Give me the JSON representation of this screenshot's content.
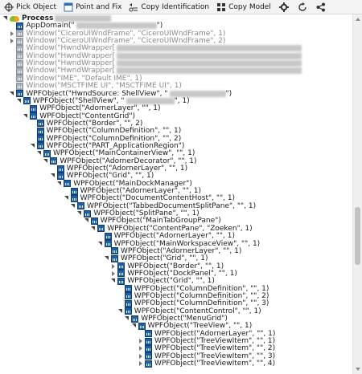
{
  "toolbar": {
    "pick_object": "Pick Object",
    "point_and_fix": "Point and Fix",
    "copy_identification": "Copy Identification",
    "copy_model": "Copy Model"
  },
  "tree": {
    "rows": [
      {
        "level": 0,
        "twisty": "open",
        "icon": "bug",
        "text": "Process",
        "redact": 70,
        "dim": false
      },
      {
        "level": 1,
        "twisty": "none",
        "icon": "node",
        "text": "AppDomain(\"",
        "redact": 100,
        "suffix": "\")",
        "dim": false
      },
      {
        "level": 1,
        "twisty": "closed",
        "icon": "gray",
        "text": "Window(\"CiceroUIWndFrame\", \"CiceroUIWndFrame\", 1)",
        "dim": true
      },
      {
        "level": 1,
        "twisty": "closed",
        "icon": "gray",
        "text": "Window(\"CiceroUIWndFrame\", \"CiceroUIWndFrame\", 2)",
        "dim": true
      },
      {
        "level": 1,
        "twisty": "none",
        "icon": "gray",
        "text": "Window(\"HwndWrapper[",
        "redact": 230,
        "dim": true
      },
      {
        "level": 1,
        "twisty": "none",
        "icon": "gray",
        "text": "Window(\"HwndWrapper[",
        "redact": 230,
        "dim": true
      },
      {
        "level": 1,
        "twisty": "none",
        "icon": "gray",
        "text": "Window(\"HwndWrapper[",
        "redact": 230,
        "dim": true
      },
      {
        "level": 1,
        "twisty": "none",
        "icon": "gray",
        "text": "Window(\"HwndWrapper[",
        "redact": 230,
        "dim": true
      },
      {
        "level": 1,
        "twisty": "none",
        "icon": "gray",
        "text": "Window(\"IME\", \"Default IME\", 1)",
        "dim": true
      },
      {
        "level": 1,
        "twisty": "none",
        "icon": "gray",
        "text": "Window(\"MSCTFIME UI\", \"MSCTFIME UI\", 1)",
        "dim": true
      },
      {
        "level": 1,
        "twisty": "open",
        "icon": "node",
        "text": "WPFObject(\"HwndSource: ShellView\", \"",
        "redact": 70,
        "suffix": "\")",
        "dim": false
      },
      {
        "level": 2,
        "twisty": "open",
        "icon": "node",
        "text": "WPFObject(\"ShellView\", \"",
        "redact": 60,
        "suffix": "\", 1)",
        "dim": false
      },
      {
        "level": 3,
        "twisty": "none",
        "icon": "node",
        "text": "WPFObject(\"AdornerLayer\", \"\", 1)",
        "dim": false
      },
      {
        "level": 3,
        "twisty": "open",
        "icon": "node",
        "text": "WPFObject(\"ContentGrid\")",
        "dim": false
      },
      {
        "level": 4,
        "twisty": "none",
        "icon": "node",
        "text": "WPFObject(\"Border\", \"\", 2)",
        "dim": false
      },
      {
        "level": 4,
        "twisty": "none",
        "icon": "node",
        "text": "WPFObject(\"ColumnDefinition\", \"\", 1)",
        "dim": false
      },
      {
        "level": 4,
        "twisty": "none",
        "icon": "node",
        "text": "WPFObject(\"ColumnDefinition\", \"\", 2)",
        "dim": false
      },
      {
        "level": 4,
        "twisty": "open",
        "icon": "node",
        "text": "WPFObject(\"PART_ApplicationRegion\")",
        "dim": false
      },
      {
        "level": 5,
        "twisty": "open",
        "icon": "node",
        "text": "WPFObject(\"MainContainerView\", \"\", 1)",
        "dim": false
      },
      {
        "level": 6,
        "twisty": "open",
        "icon": "node",
        "text": "WPFObject(\"AdornerDecorator\", \"\", 1)",
        "dim": false
      },
      {
        "level": 7,
        "twisty": "none",
        "icon": "node",
        "text": "WPFObject(\"AdornerLayer\", \"\", 1)",
        "dim": false
      },
      {
        "level": 7,
        "twisty": "open",
        "icon": "node",
        "text": "WPFObject(\"Grid\", \"\", 1)",
        "dim": false
      },
      {
        "level": 8,
        "twisty": "open",
        "icon": "node",
        "text": "WPFObject(\"MainDockManager\")",
        "dim": false
      },
      {
        "level": 9,
        "twisty": "none",
        "icon": "node",
        "text": "WPFObject(\"AdornerLayer\", \"\", 1)",
        "dim": false
      },
      {
        "level": 9,
        "twisty": "open",
        "icon": "node",
        "text": "WPFObject(\"DocumentContentHost\", \"\", 1)",
        "dim": false
      },
      {
        "level": 10,
        "twisty": "open",
        "icon": "node",
        "text": "WPFObject(\"TabbedDocumentSplitPane\", \"\", 1)",
        "dim": false
      },
      {
        "level": 11,
        "twisty": "open",
        "icon": "node",
        "text": "WPFObject(\"SplitPane\", \"\", 1)",
        "dim": false
      },
      {
        "level": 12,
        "twisty": "open",
        "icon": "node",
        "text": "WPFObject(\"MainTabGroupPane\")",
        "dim": false
      },
      {
        "level": 13,
        "twisty": "open",
        "icon": "node",
        "text": "WPFObject(\"ContentPane\", \"Zoeken\", 1)",
        "dim": false
      },
      {
        "level": 14,
        "twisty": "none",
        "icon": "node",
        "text": "WPFObject(\"AdornerLayer\", \"\", 1)",
        "dim": false
      },
      {
        "level": 14,
        "twisty": "open",
        "icon": "node",
        "text": "WPFObject(\"MainWorkspaceView\", \"\", 1)",
        "dim": false
      },
      {
        "level": 15,
        "twisty": "none",
        "icon": "node",
        "text": "WPFObject(\"AdornerLayer\", \"\", 1)",
        "dim": false
      },
      {
        "level": 15,
        "twisty": "open",
        "icon": "node",
        "text": "WPFObject(\"Grid\", \"\", 1)",
        "dim": false
      },
      {
        "level": 16,
        "twisty": "closed",
        "icon": "node",
        "text": "WPFObject(\"Border\", \"\", 1)",
        "dim": false
      },
      {
        "level": 16,
        "twisty": "closed",
        "icon": "node",
        "text": "WPFObject(\"DockPanel\", \"\", 1)",
        "dim": false
      },
      {
        "level": 16,
        "twisty": "open",
        "icon": "node",
        "text": "WPFObject(\"Grid\", \"\", 1)",
        "dim": false
      },
      {
        "level": 17,
        "twisty": "none",
        "icon": "node",
        "text": "WPFObject(\"ColumnDefinition\", \"\", 1)",
        "dim": false
      },
      {
        "level": 17,
        "twisty": "none",
        "icon": "node",
        "text": "WPFObject(\"ColumnDefinition\", \"\", 2)",
        "dim": false
      },
      {
        "level": 17,
        "twisty": "none",
        "icon": "node",
        "text": "WPFObject(\"ColumnDefinition\", \"\", 3)",
        "dim": false
      },
      {
        "level": 17,
        "twisty": "open",
        "icon": "node",
        "text": "WPFObject(\"ContentControl\", \"\", 1)",
        "dim": false
      },
      {
        "level": 18,
        "twisty": "open",
        "icon": "node",
        "text": "WPFObject(\"MenuGrid\")",
        "dim": false
      },
      {
        "level": 19,
        "twisty": "open",
        "icon": "node",
        "text": "WPFObject(\"TreeView\", \"\", 1)",
        "dim": false
      },
      {
        "level": 20,
        "twisty": "none",
        "icon": "node",
        "text": "WPFObject(\"AdornerLayer\", \"\", 1)",
        "dim": false
      },
      {
        "level": 20,
        "twisty": "closed",
        "icon": "node",
        "text": "WPFObject(\"TreeViewItem\", \"\", 1)",
        "dim": false
      },
      {
        "level": 20,
        "twisty": "closed",
        "icon": "node",
        "text": "WPFObject(\"TreeViewItem\", \"\", 2)",
        "dim": false
      },
      {
        "level": 20,
        "twisty": "closed",
        "icon": "node",
        "text": "WPFObject(\"TreeViewItem\", \"\", 3)",
        "dim": false
      },
      {
        "level": 20,
        "twisty": "closed",
        "icon": "node",
        "text": "WPFObject(\"TreeViewItem\", \"\", 4)",
        "dim": false
      }
    ]
  }
}
